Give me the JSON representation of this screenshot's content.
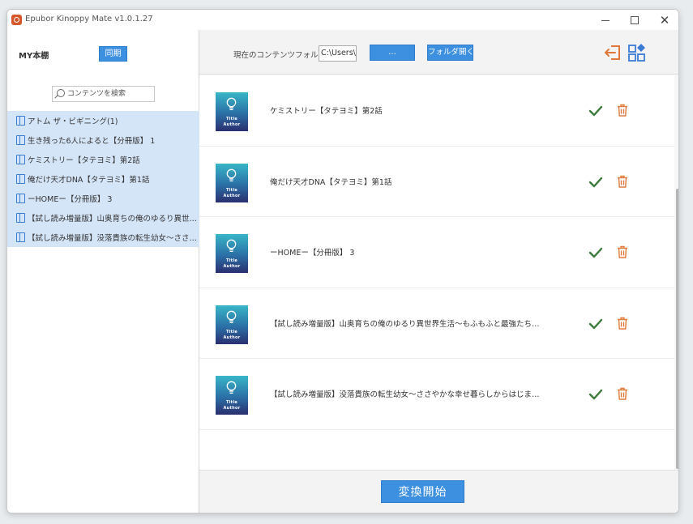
{
  "window": {
    "title": "Epubor Kinoppy Mate v1.0.1.27",
    "close_glyph": "✕"
  },
  "sidebar": {
    "library_label": "MY本棚",
    "import_label": "同期",
    "search_placeholder": "コンテンツを検索",
    "books": [
      "アトム ザ・ビギニング(1)",
      "生き残った6人によると【分冊版】 1",
      "ケミストリー【タテヨミ】第2話",
      "俺だけ天才DNA【タテヨミ】第1話",
      "ーHOMEー【分冊版】 3",
      "【試し読み増量版】山奥育ちの俺のゆるり異世界生活～もふもふと最強たちに可愛がられて、二度目の人生満喫中～",
      "【試し読み増量版】没落貴族の転生幼女～ささやかな幸せ暮らしからはじまる～"
    ]
  },
  "topbar": {
    "folder_label": "現在のコンテンツフォルダ：",
    "folder_path": "C:\\Users\\a",
    "browse_label": "...",
    "open_folder_label": "フォルダ開く"
  },
  "converted_books": [
    {
      "title": "ケミストリー【タテヨミ】第2話",
      "cover_title": "Title",
      "cover_author": "Author"
    },
    {
      "title": "俺だけ天才DNA【タテヨミ】第1話",
      "cover_title": "Title",
      "cover_author": "Author"
    },
    {
      "title": "ーHOMEー【分冊版】 3",
      "cover_title": "Title",
      "cover_author": "Author"
    },
    {
      "title": "【試し読み増量版】山奥育ちの俺のゆるり異世界生活～もふもふと最強たちに可愛がられて、二度目の人生満喫中～",
      "cover_title": "Title",
      "cover_author": "Author"
    },
    {
      "title": "【試し読み増量版】没落貴族の転生幼女～ささやかな幸せ暮らしからはじまる～",
      "cover_title": "Title",
      "cover_author": "Author"
    }
  ],
  "bottombar": {
    "convert_label": "変換開始"
  },
  "colors": {
    "accent": "#3d8fe0",
    "selected_row": "#d5e5f8",
    "check": "#3c7a3c",
    "trash": "#e07a3c"
  },
  "icons": {
    "logout": "logout-icon",
    "apps": "apps-icon",
    "check": "check-icon",
    "trash": "trash-icon",
    "book": "book-icon",
    "search": "search-icon"
  }
}
